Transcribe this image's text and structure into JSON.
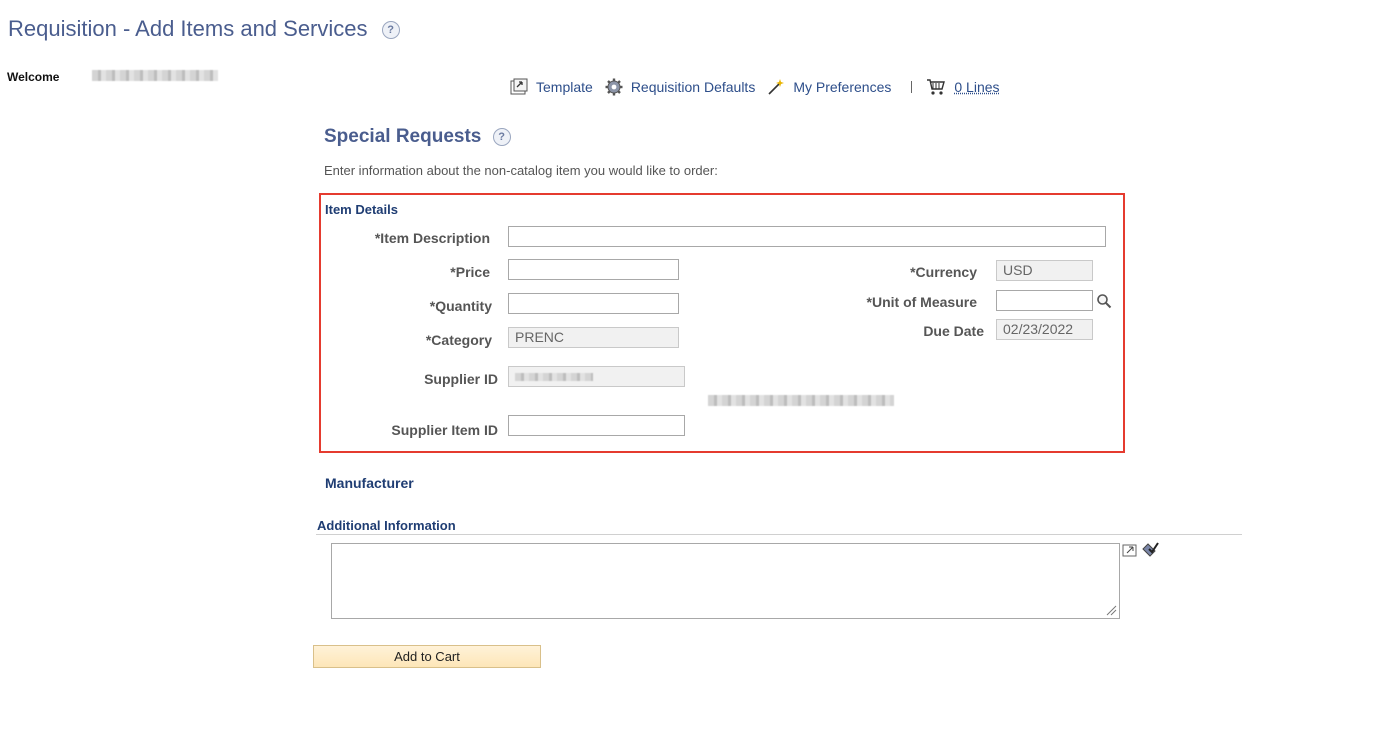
{
  "header": {
    "title": "Requisition - Add Items and Services",
    "welcome_label": "Welcome"
  },
  "toolbar": {
    "template_label": "Template",
    "defaults_label": "Requisition Defaults",
    "preferences_label": "My Preferences",
    "cart_lines_label": "0 Lines"
  },
  "special_requests": {
    "title": "Special Requests",
    "intro": "Enter information about the non-catalog item you would like to order:"
  },
  "item_details": {
    "group_label": "Item Details",
    "item_description_label": "*Item Description",
    "item_description_value": "",
    "price_label": "*Price",
    "price_value": "",
    "quantity_label": "*Quantity",
    "quantity_value": "",
    "category_label": "*Category",
    "category_value": "PRENC",
    "supplier_id_label": "Supplier ID",
    "supplier_item_id_label": "Supplier Item ID",
    "supplier_item_id_value": "",
    "currency_label": "*Currency",
    "currency_value": "USD",
    "uom_label": "*Unit of Measure",
    "uom_value": "",
    "due_date_label": "Due Date",
    "due_date_value": "02/23/2022"
  },
  "manufacturer": {
    "label": "Manufacturer"
  },
  "additional_info": {
    "label": "Additional Information",
    "value": ""
  },
  "actions": {
    "add_to_cart_label": "Add to Cart"
  },
  "icons": {
    "help": "help-icon",
    "template": "template-icon",
    "defaults": "gear-icon",
    "preferences": "magic-wand-icon",
    "cart": "shopping-cart-icon",
    "lookup": "search-icon",
    "expand": "expand-icon",
    "spellcheck": "spellcheck-icon"
  },
  "colors": {
    "title": "#4a5d8e",
    "link": "#2d4e8a",
    "highlight_border": "#e53b2f",
    "button_bg": "#fde6b8"
  }
}
